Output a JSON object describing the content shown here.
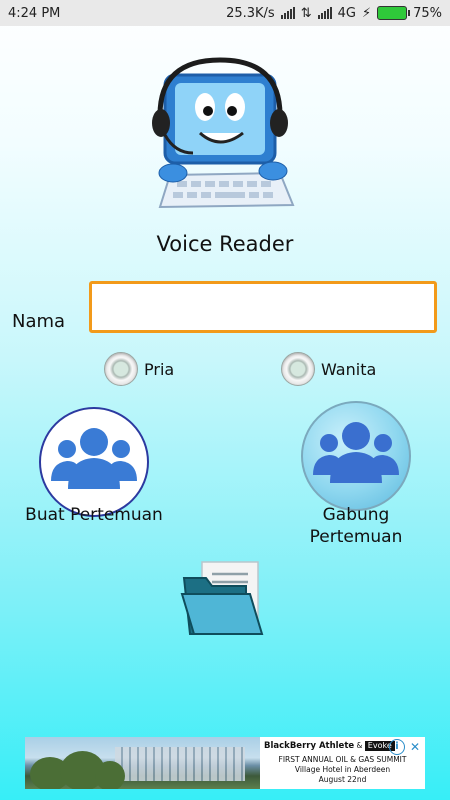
{
  "status_bar": {
    "time": "4:24 PM",
    "speed": "25.3K/s",
    "network": "4G",
    "battery": "75%"
  },
  "app": {
    "title": "Voice Reader",
    "name_label": "Nama",
    "name_value": "",
    "gender_options": [
      "Pria",
      "Wanita"
    ],
    "buttons": {
      "create_meeting": "Buat Pertemuan",
      "join_meeting_line1": "Gabung",
      "join_meeting_line2": "Pertemuan"
    }
  },
  "ad": {
    "brand": "BlackBerry Athlete",
    "and": "&",
    "partner": "Evoke",
    "line1": "FIRST ANNUAL OIL & GAS SUMMIT",
    "line2": "Village Hotel in Aberdeen",
    "line3": "August 22nd",
    "info_icon": "i",
    "close_icon": "✕"
  },
  "colors": {
    "input_border": "#f29a1a",
    "group_icon": "#3a7bd5",
    "buat_border": "#2c3aa0"
  }
}
